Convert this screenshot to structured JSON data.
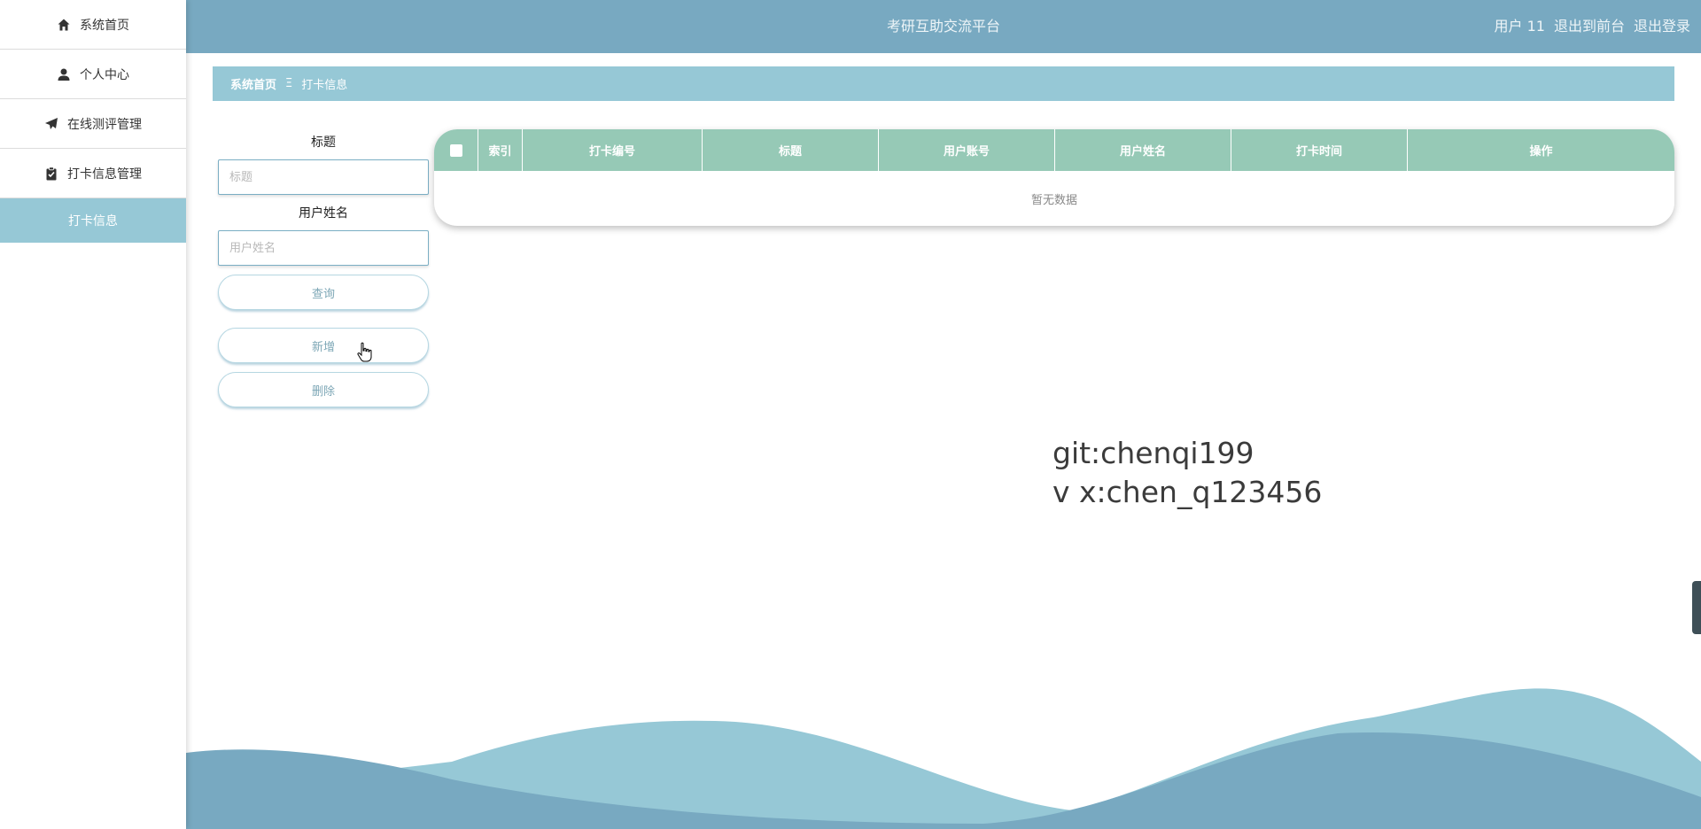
{
  "sidebar": {
    "items": [
      {
        "label": "系统首页",
        "icon": "home-icon"
      },
      {
        "label": "个人中心",
        "icon": "user-icon"
      },
      {
        "label": "在线测评管理",
        "icon": "paper-plane-icon"
      },
      {
        "label": "打卡信息管理",
        "icon": "clipboard-icon"
      }
    ],
    "active_sub": "打卡信息"
  },
  "header": {
    "title": "考研互助交流平台",
    "user": "用户 11",
    "front_link": "退出到前台",
    "logout_link": "退出登录"
  },
  "breadcrumb": {
    "home": "系统首页",
    "separator": "Ξ",
    "current": "打卡信息"
  },
  "search": {
    "title_label": "标题",
    "title_placeholder": "标题",
    "title_value": "",
    "name_label": "用户姓名",
    "name_placeholder": "用户姓名",
    "name_value": "",
    "query_button": "查询",
    "add_button": "新增",
    "delete_button": "删除"
  },
  "table": {
    "columns": [
      "索引",
      "打卡编号",
      "标题",
      "用户账号",
      "用户姓名",
      "打卡时间",
      "操作"
    ],
    "rows": [],
    "empty_text": "暂无数据"
  },
  "watermark": {
    "line1": "git:chenqi199",
    "line2": "v x:chen_q123456"
  },
  "colors": {
    "header_bg": "#78a9c1",
    "breadcrumb_bg": "#96c8d6",
    "table_header_bg": "#96c9b6",
    "wave_light": "#96c8d6",
    "wave_dark": "#78a9c1"
  }
}
